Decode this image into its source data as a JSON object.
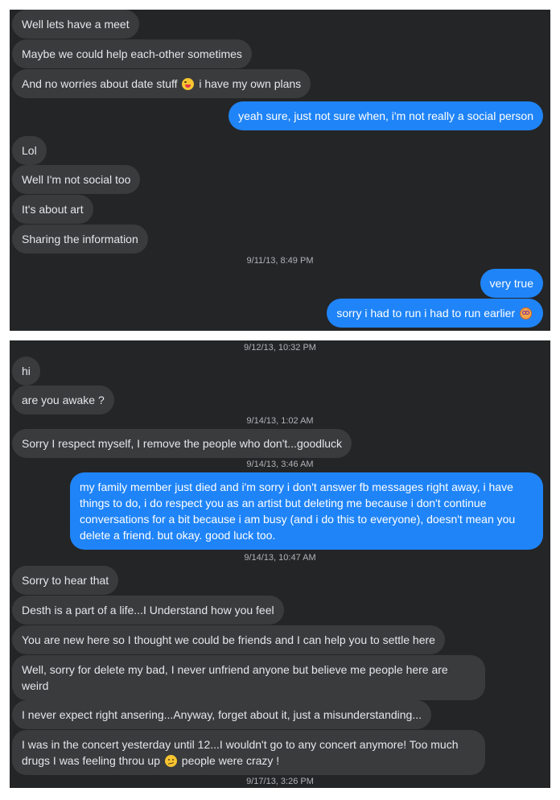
{
  "conversation": {
    "part1": [
      {
        "text": "Well lets have a meet"
      },
      {
        "text": "Maybe we could help each-other sometimes"
      },
      {
        "text": "And no worries about date stuff",
        "emoji": "winking-face-tongue",
        "after": "i have my own plans"
      },
      {
        "text": "yeah sure, just not sure when, i'm not really a social person"
      },
      {
        "text": "Lol"
      },
      {
        "text": "Well I'm not social too"
      },
      {
        "text": "It's about art"
      },
      {
        "text": "Sharing the information"
      },
      {
        "timestamp": "9/11/13, 8:49 PM"
      },
      {
        "text": "very true"
      },
      {
        "text": "sorry i had to run i had to run earlier",
        "emoji": "dizzy-face"
      }
    ],
    "part2": [
      {
        "timestamp": "9/12/13, 10:32 PM"
      },
      {
        "text": "hi"
      },
      {
        "text": "are you awake ?"
      },
      {
        "timestamp": "9/14/13, 1:02 AM"
      },
      {
        "text": "Sorry I respect myself, I remove the people who don't...goodluck"
      },
      {
        "timestamp": "9/14/13, 3:46 AM"
      },
      {
        "text": "my family member just died and i'm sorry i don't answer fb messages right away, i have things to do, i do respect you as an artist but deleting me because i don't continue conversations for a bit because i am busy (and i do this to everyone), doesn't mean you delete a friend. but okay. good luck too."
      },
      {
        "timestamp": "9/14/13, 10:47 AM"
      },
      {
        "text": "Sorry to hear that"
      },
      {
        "text": "Desth is a part of a life...I Understand how you feel"
      },
      {
        "text": "You are new here so I thought we could be friends and I can help you to settle here"
      },
      {
        "text": "Well, sorry for delete my bad, I never unfriend anyone but believe me people here are weird"
      },
      {
        "text": "I never expect right ansering...Anyway, forget about it, just a misunderstanding..."
      },
      {
        "text": "I was in the concert yesterday until 12...I wouldn't go to any concert anymore! Too much drugs I was feeling throu up",
        "emoji": "confused-face",
        "after": "people were crazy !"
      },
      {
        "timestamp": "9/17/13, 3:26 PM"
      }
    ]
  },
  "colors": {
    "background": "#242526",
    "incoming_bubble": "#3a3b3c",
    "outgoing_bubble": "#1f84f7",
    "text": "#e4e6eb",
    "timestamp": "#b0b3b8"
  }
}
